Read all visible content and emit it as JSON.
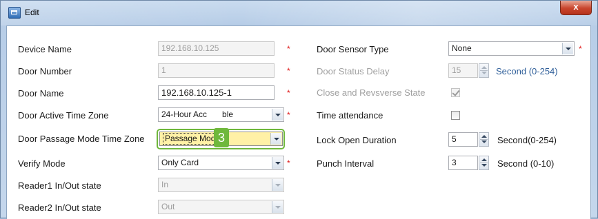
{
  "window": {
    "title": "Edit",
    "close_label": "x"
  },
  "left": {
    "device_name": {
      "label": "Device Name",
      "value": "192.168.10.125",
      "required": "*"
    },
    "door_number": {
      "label": "Door Number",
      "value": "1",
      "required": "*"
    },
    "door_name": {
      "label": "Door Name",
      "value": "192.168.10.125-1",
      "required": "*"
    },
    "door_active_tz": {
      "label": "Door Active Time Zone",
      "value": "24-Hour Accessible",
      "value_visible_left": "24-Hour Acc",
      "value_visible_right": "ble",
      "required": "*"
    },
    "door_passage_tz": {
      "label": "Door Passage Mode Time Zone",
      "value": "Passage Mode"
    },
    "verify_mode": {
      "label": "Verify Mode",
      "value": "Only Card",
      "required": "*"
    },
    "reader1": {
      "label": "Reader1 In/Out state",
      "value": "In"
    },
    "reader2": {
      "label": "Reader2 In/Out state",
      "value": "Out"
    }
  },
  "right": {
    "door_sensor_type": {
      "label": "Door Sensor Type",
      "value": "None",
      "required": "*"
    },
    "door_status_delay": {
      "label": "Door Status Delay",
      "value": "15",
      "unit": "Second (0-254)"
    },
    "close_reverse_state": {
      "label": "Close and Revsverse State",
      "checked": true
    },
    "time_attendance": {
      "label": "Time attendance",
      "checked": false
    },
    "lock_open_duration": {
      "label": "Lock Open Duration",
      "value": "5",
      "unit": "Second(0-254)"
    },
    "punch_interval": {
      "label": "Punch Interval",
      "value": "3",
      "unit": "Second (0-10)"
    }
  },
  "annotation": {
    "step_number": "3"
  },
  "colors": {
    "highlight_green": "#6fb83c",
    "required_red": "#e01b1b",
    "unit_blue": "#2e5e99",
    "selected_yellow": "#fff1a6"
  }
}
